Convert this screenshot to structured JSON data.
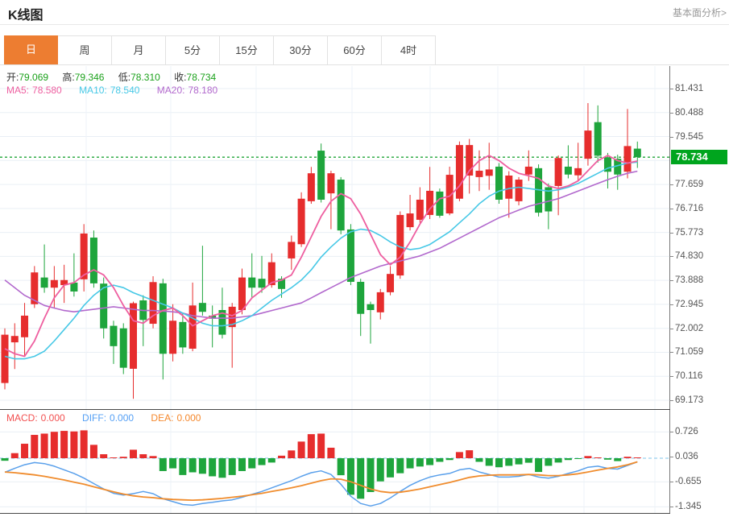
{
  "header": {
    "title": "K线图",
    "link": "基本面分析>"
  },
  "tabs": {
    "selected_index": 0,
    "items": [
      {
        "key": "tab-day",
        "label": "日"
      },
      {
        "key": "tab-week",
        "label": "周"
      },
      {
        "key": "tab-month",
        "label": "月"
      },
      {
        "key": "tab-5min",
        "label": "5分"
      },
      {
        "key": "tab-15min",
        "label": "15分"
      },
      {
        "key": "tab-30min",
        "label": "30分"
      },
      {
        "key": "tab-60min",
        "label": "60分"
      },
      {
        "key": "tab-4hour",
        "label": "4时"
      }
    ]
  },
  "ohlc_info": {
    "open_label": "开:",
    "open": "79.069",
    "high_label": "高:",
    "high": "79.346",
    "low_label": "低:",
    "low": "78.310",
    "close_label": "收:",
    "close": "78.734"
  },
  "ma_info": {
    "ma5_label": "MA5:",
    "ma5": "78.580",
    "ma10_label": "MA10:",
    "ma10": "78.540",
    "ma20_label": "MA20:",
    "ma20": "78.180"
  },
  "macd_info": {
    "macd_label": "MACD:",
    "macd": "0.000",
    "diff_label": "DIFF:",
    "diff": "0.000",
    "dea_label": "DEA:",
    "dea": "0.000"
  },
  "colors": {
    "up": "#e62d2d",
    "down": "#1ea53c",
    "badge": "#00a51e",
    "last_line": "#21a537",
    "ma5": "#ee5fa0",
    "ma10": "#46c8e6",
    "ma20": "#b269cd",
    "diff": "#5aa0eb",
    "dea": "#f08c2d",
    "grid": "#e9eff5",
    "vgrid": "#eef3f8",
    "tab_selected": "#ed7d31",
    "zero_dash": "#7fc4ea"
  },
  "chart_data": {
    "type": "candlestick",
    "last_price": "78.734",
    "price_axis": {
      "labels": [
        "81.431",
        "80.488",
        "79.545",
        "77.659",
        "76.716",
        "75.773",
        "74.830",
        "73.888",
        "72.945",
        "72.002",
        "71.059",
        "70.116",
        "69.173"
      ],
      "top": 81.431,
      "step": 0.943,
      "gridline_count": 14
    },
    "candles": [
      [
        69.85,
        72.0,
        69.6,
        71.75
      ],
      [
        71.45,
        72.2,
        70.4,
        71.7
      ],
      [
        71.65,
        73.0,
        70.9,
        72.5
      ],
      [
        72.95,
        74.45,
        72.8,
        74.2
      ],
      [
        74.0,
        75.3,
        73.4,
        73.6
      ],
      [
        73.6,
        74.45,
        72.8,
        73.9
      ],
      [
        73.7,
        74.5,
        73.0,
        73.9
      ],
      [
        73.8,
        74.95,
        73.25,
        73.45
      ],
      [
        73.93,
        76.1,
        73.45,
        75.73
      ],
      [
        75.57,
        75.85,
        73.6,
        73.77
      ],
      [
        73.76,
        74.0,
        71.6,
        72.0
      ],
      [
        72.1,
        72.3,
        70.6,
        71.3
      ],
      [
        72.0,
        72.2,
        70.2,
        70.45
      ],
      [
        70.41,
        73.05,
        69.23,
        72.99
      ],
      [
        73.1,
        73.3,
        71.3,
        72.33
      ],
      [
        72.18,
        74.05,
        72.0,
        73.82
      ],
      [
        73.77,
        73.95,
        69.99,
        71.0
      ],
      [
        71.0,
        72.95,
        70.7,
        72.3
      ],
      [
        72.25,
        72.6,
        71.0,
        71.25
      ],
      [
        71.2,
        73.8,
        71.1,
        72.9
      ],
      [
        73.0,
        75.25,
        72.5,
        72.65
      ],
      [
        72.5,
        72.9,
        71.25,
        72.38
      ],
      [
        72.72,
        73.6,
        71.6,
        71.75
      ],
      [
        72.05,
        73.0,
        70.45,
        72.85
      ],
      [
        72.72,
        74.35,
        72.55,
        74.0
      ],
      [
        74.0,
        74.95,
        73.2,
        73.6
      ],
      [
        73.95,
        74.85,
        73.4,
        73.6
      ],
      [
        73.7,
        74.95,
        73.6,
        74.6
      ],
      [
        73.95,
        74.05,
        73.2,
        73.55
      ],
      [
        74.75,
        75.65,
        74.3,
        75.4
      ],
      [
        75.31,
        77.35,
        75.2,
        77.1
      ],
      [
        77.0,
        78.35,
        76.9,
        78.1
      ],
      [
        78.99,
        79.27,
        76.95,
        77.06
      ],
      [
        77.31,
        78.2,
        75.9,
        78.1
      ],
      [
        77.85,
        77.95,
        75.7,
        75.85
      ],
      [
        75.89,
        76.1,
        73.7,
        73.83
      ],
      [
        73.83,
        73.95,
        71.7,
        72.57
      ],
      [
        72.95,
        73.05,
        71.4,
        72.72
      ],
      [
        72.63,
        73.55,
        72.35,
        73.42
      ],
      [
        73.42,
        74.45,
        73.3,
        74.14
      ],
      [
        74.08,
        76.6,
        73.95,
        76.46
      ],
      [
        75.98,
        77.25,
        75.85,
        76.52
      ],
      [
        76.27,
        77.55,
        76.15,
        77.06
      ],
      [
        76.46,
        78.35,
        76.3,
        77.41
      ],
      [
        77.38,
        77.5,
        76.35,
        76.43
      ],
      [
        76.52,
        78.36,
        76.45,
        78.04
      ],
      [
        77.1,
        79.35,
        77.0,
        79.21
      ],
      [
        78.01,
        79.45,
        77.3,
        79.21
      ],
      [
        77.95,
        79.0,
        77.4,
        78.2
      ],
      [
        78.0,
        79.3,
        77.45,
        78.25
      ],
      [
        78.36,
        78.5,
        76.9,
        77.06
      ],
      [
        77.1,
        78.18,
        76.35,
        78.01
      ],
      [
        77.0,
        77.95,
        76.84,
        77.85
      ],
      [
        78.05,
        79.0,
        77.8,
        78.36
      ],
      [
        78.3,
        78.45,
        76.4,
        76.55
      ],
      [
        77.55,
        77.7,
        75.9,
        76.6
      ],
      [
        77.6,
        78.8,
        76.45,
        78.7
      ],
      [
        78.36,
        79.2,
        77.9,
        78.05
      ],
      [
        78.02,
        79.3,
        77.8,
        78.3
      ],
      [
        78.67,
        80.86,
        78.4,
        79.78
      ],
      [
        80.11,
        80.77,
        78.52,
        78.79
      ],
      [
        78.73,
        78.9,
        77.5,
        78.16
      ],
      [
        78.67,
        78.83,
        77.45,
        78.05
      ],
      [
        78.16,
        80.63,
        77.9,
        79.17
      ],
      [
        79.069,
        79.346,
        78.31,
        78.734
      ]
    ],
    "ma5": [
      71.2,
      71.0,
      70.9,
      71.5,
      72.4,
      73.2,
      73.7,
      73.8,
      74.1,
      74.3,
      74.1,
      73.6,
      72.9,
      72.3,
      72.2,
      72.5,
      72.7,
      72.8,
      72.5,
      72.1,
      72.3,
      72.5,
      72.6,
      72.5,
      72.7,
      73.2,
      73.5,
      73.8,
      73.9,
      74.1,
      74.8,
      75.6,
      76.4,
      77.0,
      77.3,
      77.1,
      76.5,
      75.7,
      74.9,
      74.5,
      74.8,
      75.4,
      76.1,
      76.7,
      77.1,
      77.2,
      77.6,
      78.2,
      78.6,
      78.8,
      78.6,
      78.3,
      78.1,
      78.0,
      77.9,
      77.6,
      77.5,
      77.6,
      77.8,
      78.2,
      78.6,
      78.8,
      78.6,
      78.5,
      78.58
    ],
    "ma10": [
      70.9,
      70.8,
      70.8,
      70.9,
      71.1,
      71.5,
      71.95,
      72.4,
      72.9,
      73.3,
      73.6,
      73.7,
      73.6,
      73.4,
      73.25,
      73.1,
      72.95,
      72.8,
      72.6,
      72.4,
      72.2,
      72.1,
      72.1,
      72.15,
      72.3,
      72.5,
      72.8,
      73.1,
      73.35,
      73.6,
      73.9,
      74.3,
      74.8,
      75.2,
      75.55,
      75.8,
      75.9,
      75.85,
      75.65,
      75.4,
      75.2,
      75.1,
      75.15,
      75.3,
      75.55,
      75.8,
      76.15,
      76.5,
      76.9,
      77.2,
      77.4,
      77.5,
      77.55,
      77.5,
      77.45,
      77.4,
      77.45,
      77.55,
      77.7,
      77.9,
      78.1,
      78.3,
      78.4,
      78.5,
      78.54
    ],
    "ma20": [
      73.9,
      73.6,
      73.3,
      73.1,
      72.9,
      72.8,
      72.7,
      72.65,
      72.7,
      72.75,
      72.8,
      72.85,
      72.8,
      72.75,
      72.7,
      72.7,
      72.68,
      72.65,
      72.6,
      72.5,
      72.45,
      72.4,
      72.4,
      72.4,
      72.45,
      72.5,
      72.6,
      72.7,
      72.8,
      72.9,
      73.0,
      73.2,
      73.4,
      73.6,
      73.8,
      74.0,
      74.15,
      74.3,
      74.45,
      74.55,
      74.65,
      74.75,
      74.85,
      75.0,
      75.15,
      75.35,
      75.55,
      75.75,
      75.95,
      76.15,
      76.35,
      76.5,
      76.65,
      76.8,
      76.9,
      77.0,
      77.1,
      77.25,
      77.4,
      77.55,
      77.7,
      77.85,
      77.98,
      78.1,
      78.18
    ],
    "macd": {
      "axis_labels": [
        "0.726",
        "0.036",
        "-0.655",
        "-1.345"
      ],
      "axis_values": [
        0.726,
        0.036,
        -0.655,
        -1.345
      ],
      "hist": [
        -0.07,
        0.14,
        0.4,
        0.645,
        0.68,
        0.73,
        0.755,
        0.74,
        0.77,
        0.37,
        0.11,
        0.02,
        0.04,
        0.235,
        0.11,
        0.06,
        -0.355,
        -0.28,
        -0.465,
        -0.39,
        -0.43,
        -0.5,
        -0.54,
        -0.465,
        -0.355,
        -0.28,
        -0.19,
        -0.12,
        0.07,
        0.215,
        0.46,
        0.665,
        0.68,
        0.29,
        -0.47,
        -1.01,
        -1.12,
        -0.935,
        -0.64,
        -0.53,
        -0.415,
        -0.28,
        -0.23,
        -0.19,
        -0.1,
        -0.05,
        0.17,
        0.22,
        -0.1,
        -0.21,
        -0.25,
        -0.21,
        -0.17,
        -0.125,
        -0.38,
        -0.21,
        -0.12,
        -0.05,
        -0.02,
        0.06,
        0.01,
        -0.04,
        -0.08,
        0.04,
        0.02
      ],
      "diff_line": [
        -0.39,
        -0.28,
        -0.18,
        -0.12,
        -0.15,
        -0.22,
        -0.32,
        -0.42,
        -0.55,
        -0.7,
        -0.85,
        -0.97,
        -1.02,
        -0.98,
        -0.92,
        -0.98,
        -1.12,
        -1.2,
        -1.28,
        -1.3,
        -1.25,
        -1.22,
        -1.18,
        -1.15,
        -1.08,
        -1.0,
        -0.92,
        -0.82,
        -0.72,
        -0.62,
        -0.5,
        -0.4,
        -0.35,
        -0.45,
        -0.72,
        -1.05,
        -1.25,
        -1.32,
        -1.25,
        -1.1,
        -0.92,
        -0.75,
        -0.62,
        -0.52,
        -0.46,
        -0.42,
        -0.32,
        -0.28,
        -0.38,
        -0.45,
        -0.52,
        -0.52,
        -0.5,
        -0.45,
        -0.52,
        -0.55,
        -0.5,
        -0.42,
        -0.35,
        -0.25,
        -0.22,
        -0.28,
        -0.3,
        -0.2,
        -0.1
      ],
      "dea_line": [
        -0.38,
        -0.4,
        -0.43,
        -0.46,
        -0.5,
        -0.55,
        -0.6,
        -0.66,
        -0.72,
        -0.79,
        -0.86,
        -0.93,
        -0.99,
        -1.04,
        -1.07,
        -1.09,
        -1.12,
        -1.14,
        -1.15,
        -1.16,
        -1.15,
        -1.13,
        -1.11,
        -1.08,
        -1.05,
        -1.01,
        -0.97,
        -0.92,
        -0.87,
        -0.82,
        -0.76,
        -0.69,
        -0.62,
        -0.57,
        -0.58,
        -0.65,
        -0.75,
        -0.85,
        -0.92,
        -0.95,
        -0.94,
        -0.9,
        -0.85,
        -0.79,
        -0.73,
        -0.67,
        -0.6,
        -0.53,
        -0.49,
        -0.47,
        -0.46,
        -0.46,
        -0.46,
        -0.45,
        -0.46,
        -0.48,
        -0.48,
        -0.46,
        -0.43,
        -0.38,
        -0.33,
        -0.28,
        -0.24,
        -0.18,
        -0.1
      ]
    }
  }
}
